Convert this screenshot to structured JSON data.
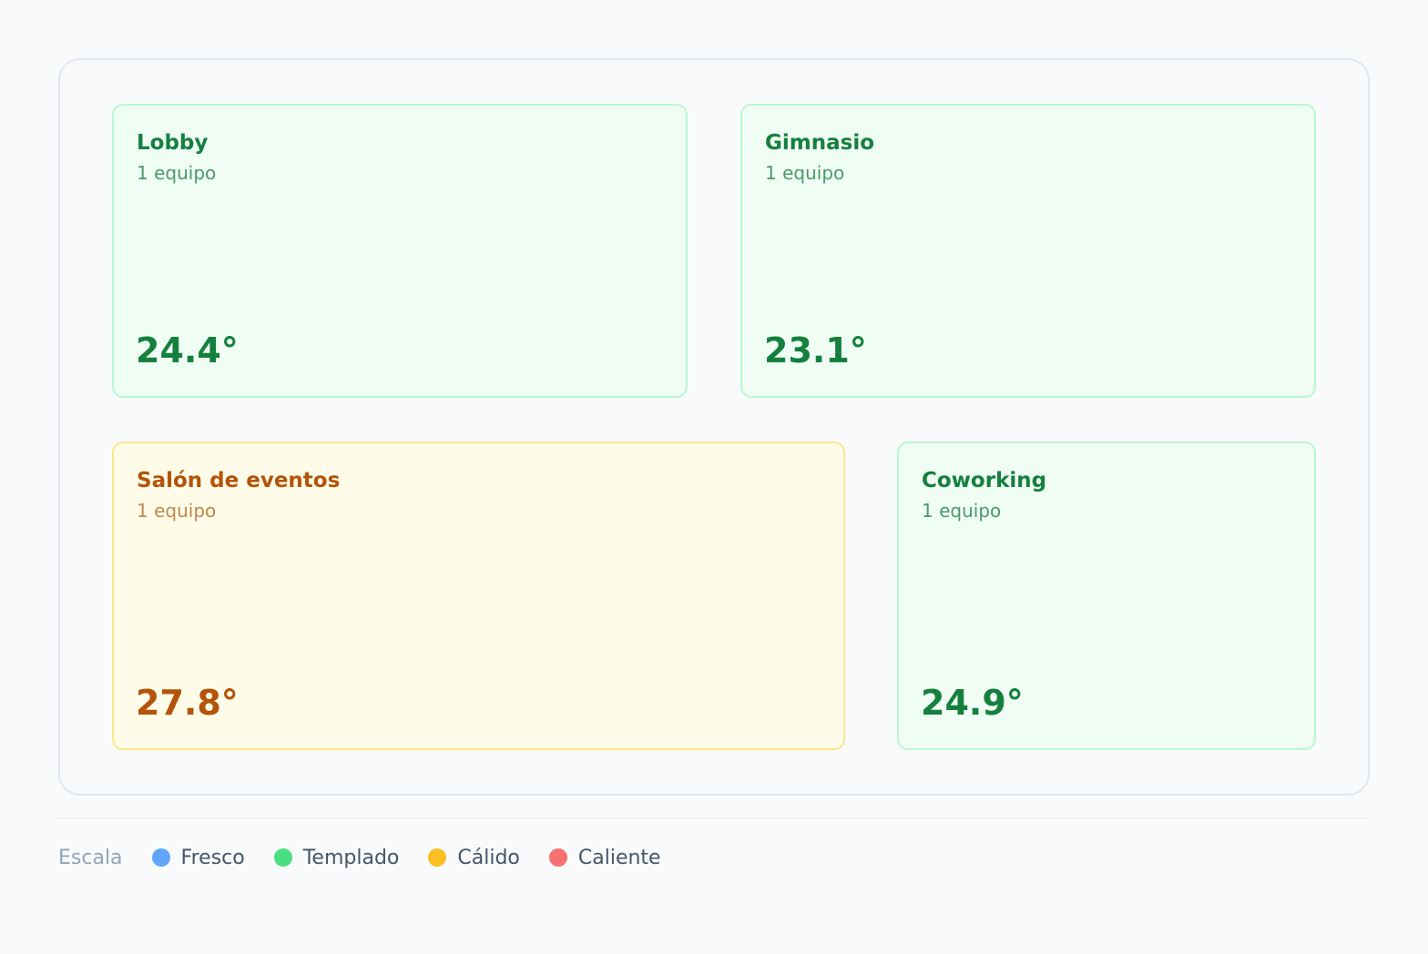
{
  "zones": [
    {
      "id": "lobby",
      "name": "Lobby",
      "count": "1 equipo",
      "temp": "24.4°",
      "level": "Templado"
    },
    {
      "id": "gimnasio",
      "name": "Gimnasio",
      "count": "1 equipo",
      "temp": "23.1°",
      "level": "Templado"
    },
    {
      "id": "salon",
      "name": "Salón de eventos",
      "count": "1 equipo",
      "temp": "27.8°",
      "level": "Cálido"
    },
    {
      "id": "cowork",
      "name": "Coworking",
      "count": "1 equipo",
      "temp": "24.9°",
      "level": "Templado"
    }
  ],
  "legend": {
    "title": "Escala",
    "items": [
      {
        "label": "Fresco",
        "color": "#60a5fa"
      },
      {
        "label": "Templado",
        "color": "#4ade80"
      },
      {
        "label": "Cálido",
        "color": "#fbbf24"
      },
      {
        "label": "Caliente",
        "color": "#f87171"
      }
    ]
  },
  "colors": {
    "templado_bg": "#f0fdf4",
    "templado_text": "#15803d",
    "calido_bg": "#fefce8",
    "calido_text": "#b45309"
  }
}
